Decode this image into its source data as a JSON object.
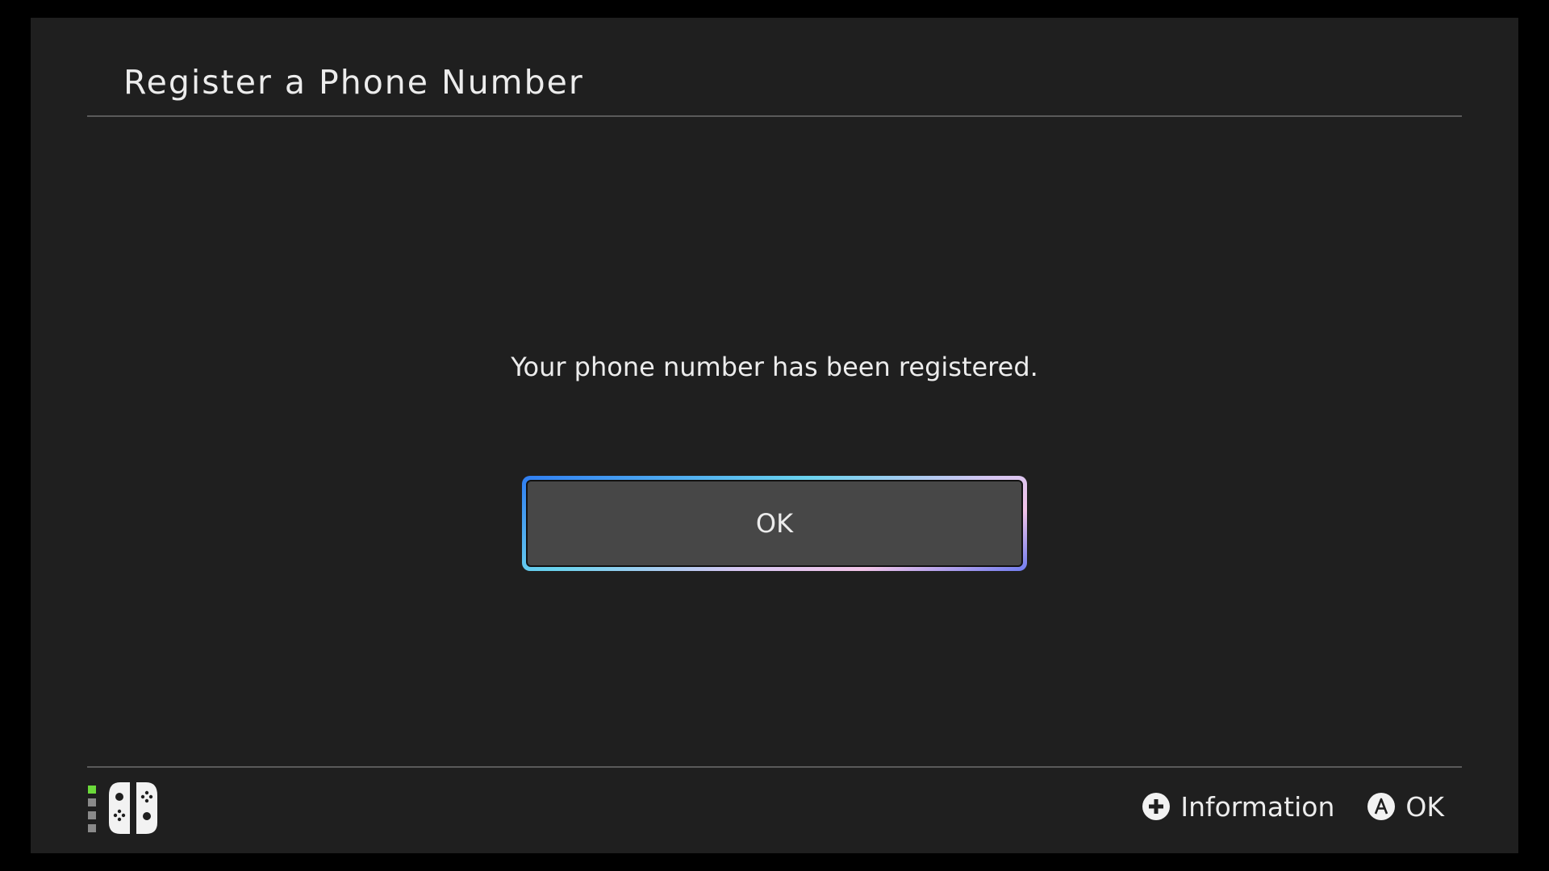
{
  "header": {
    "title": "Register a Phone Number"
  },
  "dialog": {
    "message": "Your phone number has been registered.",
    "ok_label": "OK"
  },
  "footer": {
    "controller_icon": "joycon-pair-icon",
    "player_indicator_active_color": "#6bd93a",
    "hints": [
      {
        "icon": "plus-button-icon",
        "label": "Information"
      },
      {
        "icon": "a-button-icon",
        "label": "OK"
      }
    ]
  },
  "colors": {
    "background": "#1f1f1f",
    "outer_frame": "#000000",
    "button_fill": "#474747",
    "text": "#ececec",
    "focus_gradient": [
      "#2f7df2",
      "#6ad3ee",
      "#f2c4e8",
      "#6f7cf0"
    ]
  }
}
